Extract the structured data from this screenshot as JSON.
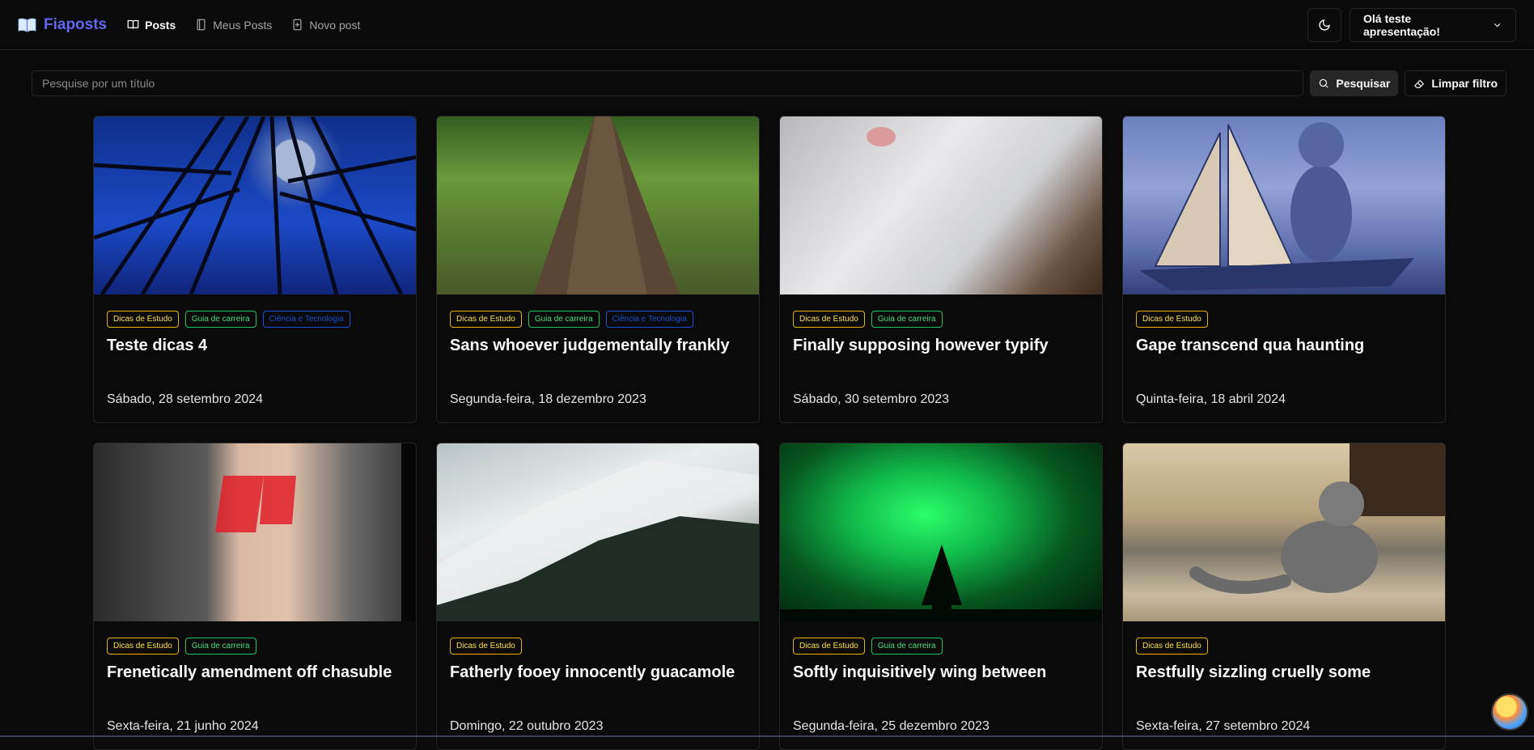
{
  "brand": {
    "name": "Fiaposts",
    "color": "#6366f1"
  },
  "nav": [
    {
      "label": "Posts",
      "icon": "book-open-icon",
      "active": true
    },
    {
      "label": "Meus Posts",
      "icon": "notebook-icon",
      "active": false
    },
    {
      "label": "Novo post",
      "icon": "file-plus-icon",
      "active": false
    }
  ],
  "user_menu": {
    "label": "Olá teste apresentação!"
  },
  "search": {
    "placeholder": "Pesquise por um título",
    "search_label": "Pesquisar",
    "clear_label": "Limpar filtro"
  },
  "tag_labels": {
    "study": "Dicas de Estudo",
    "career": "Guia de carreira",
    "tech": "Ciência e Tecnologia"
  },
  "posts": [
    {
      "title": "Teste dicas 4",
      "date": "Sábado, 28 setembro 2024",
      "tags": [
        "Dicas de Estudo",
        "Guia de carreira",
        "Ciência e Tecnologia"
      ]
    },
    {
      "title": "Sans whoever judgementally frankly",
      "date": "Segunda-feira, 18 dezembro 2023",
      "tags": [
        "Dicas de Estudo",
        "Guia de carreira",
        "Ciência e Tecnologia"
      ]
    },
    {
      "title": "Finally supposing however typify",
      "date": "Sábado, 30 setembro 2023",
      "tags": [
        "Dicas de Estudo",
        "Guia de carreira"
      ]
    },
    {
      "title": "Gape transcend qua haunting",
      "date": "Quinta-feira, 18 abril 2024",
      "tags": [
        "Dicas de Estudo"
      ]
    },
    {
      "title": "Frenetically amendment off chasuble",
      "date": "Sexta-feira, 21 junho 2024",
      "tags": [
        "Dicas de Estudo",
        "Guia de carreira"
      ]
    },
    {
      "title": "Fatherly fooey innocently guacamole",
      "date": "Domingo, 22 outubro 2023",
      "tags": [
        "Dicas de Estudo"
      ]
    },
    {
      "title": "Softly inquisitively wing between",
      "date": "Segunda-feira, 25 dezembro 2023",
      "tags": [
        "Dicas de Estudo",
        "Guia de carreira"
      ]
    },
    {
      "title": "Restfully sizzling cruelly some",
      "date": "Sexta-feira, 27 setembro 2024",
      "tags": [
        "Dicas de Estudo"
      ]
    }
  ]
}
